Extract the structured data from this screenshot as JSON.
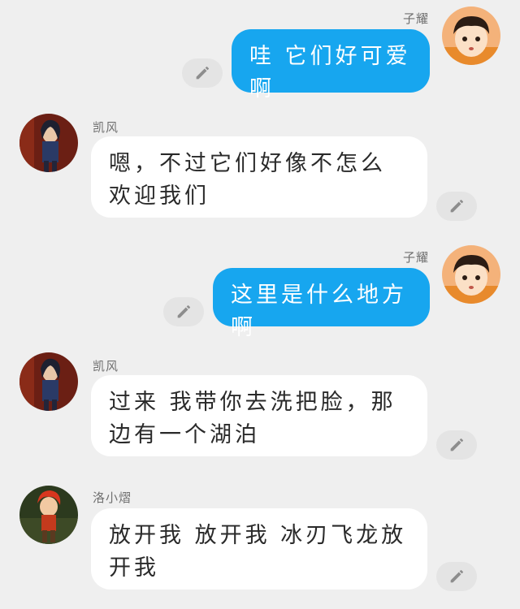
{
  "messages": [
    {
      "sender": "子耀",
      "side": "right",
      "text": "哇 它们好可爱啊",
      "avatar": "ziyao-avatar"
    },
    {
      "sender": "凯风",
      "side": "left",
      "text": "嗯，不过它们好像不怎么欢迎我们",
      "avatar": "kaifeng-avatar"
    },
    {
      "sender": "子耀",
      "side": "right",
      "text": "这里是什么地方啊",
      "avatar": "ziyao-avatar"
    },
    {
      "sender": "凯风",
      "side": "left",
      "text": "过来 我带你去洗把脸，那边有一个湖泊",
      "avatar": "kaifeng-avatar"
    },
    {
      "sender": "洛小熠",
      "side": "left",
      "text": "放开我 放开我 冰刃飞龙放开我",
      "avatar": "luoxiaoyi-avatar"
    }
  ],
  "icons": {
    "edit": "pencil-icon"
  },
  "colors": {
    "background": "#efefef",
    "right_bubble": "#17a6ef",
    "left_bubble": "#ffffff"
  }
}
